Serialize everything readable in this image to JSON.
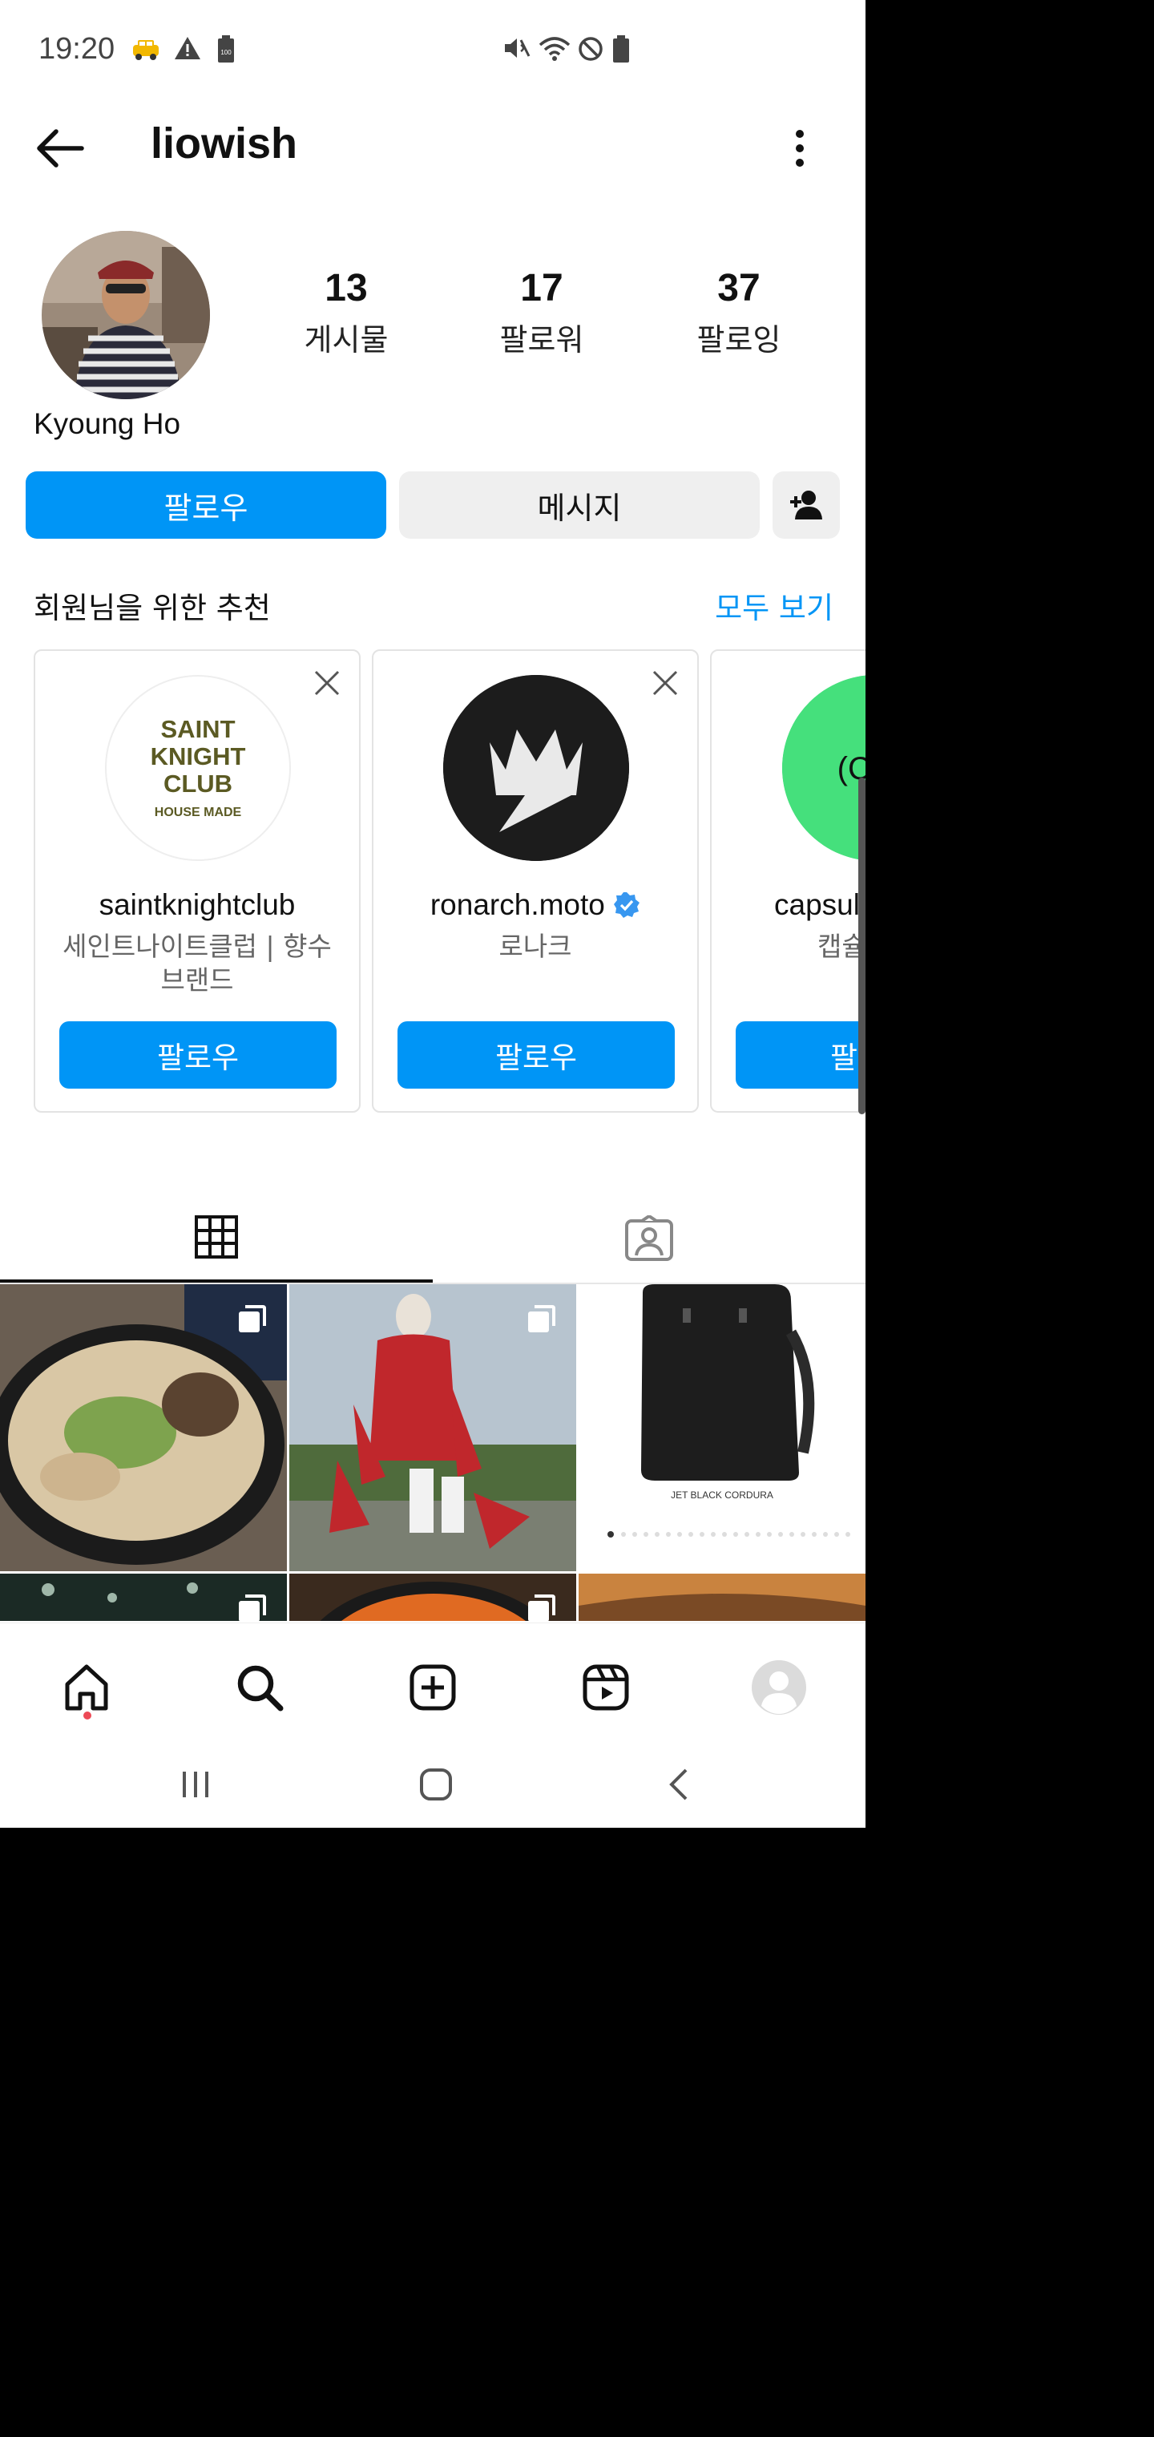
{
  "status_bar": {
    "time": "19:20",
    "left_icons": [
      "taxi-icon",
      "warning-icon",
      "battery-saver-icon"
    ],
    "right_icons": [
      "mute-icon",
      "wifi-icon",
      "do-not-disturb-icon",
      "battery-icon"
    ]
  },
  "header": {
    "username": "liowish",
    "back_icon": "arrow-left-icon",
    "menu_icon": "more-vertical-icon"
  },
  "profile": {
    "full_name": "Kyoung Ho",
    "stats": [
      {
        "value": "13",
        "label": "게시물"
      },
      {
        "value": "17",
        "label": "팔로워"
      },
      {
        "value": "37",
        "label": "팔로잉"
      }
    ],
    "follow_label": "팔로우",
    "message_label": "메시지",
    "add_person_icon": "person-add-icon"
  },
  "recommendations": {
    "title": "회원님을 위한 추천",
    "see_all": "모두 보기",
    "cards": [
      {
        "name": "saintknightclub",
        "subtitle": "세인트나이트클럽 | 향수 브랜드",
        "follow": "팔로우",
        "logo_text": [
          "SAINT",
          "KNIGHT",
          "CLUB",
          "HOUSE MADE"
        ],
        "verified": false
      },
      {
        "name": "ronarch.moto",
        "subtitle": "로나크",
        "follow": "팔로우",
        "verified": true
      },
      {
        "name": "capsul",
        "subtitle": "캡슐 (C",
        "follow": "팔로",
        "logo_text": [
          "(Cap"
        ],
        "verified": false
      }
    ]
  },
  "tabs": [
    {
      "name": "posts-grid",
      "icon": "grid-icon",
      "active": true
    },
    {
      "name": "tagged",
      "icon": "tagged-person-icon",
      "active": false
    }
  ],
  "posts": {
    "items": [
      {
        "label": "",
        "multi": true
      },
      {
        "label": "",
        "multi": true
      },
      {
        "label": "JET BLACK CORDURA",
        "multi": false
      }
    ]
  },
  "bottom_nav": [
    {
      "icon": "home-icon"
    },
    {
      "icon": "search-icon"
    },
    {
      "icon": "add-post-icon"
    },
    {
      "icon": "reels-icon"
    },
    {
      "icon": "profile-avatar-icon"
    }
  ],
  "colors": {
    "accent": "#0095f6",
    "button_gray": "#efefef",
    "notification": "#ed4956"
  }
}
